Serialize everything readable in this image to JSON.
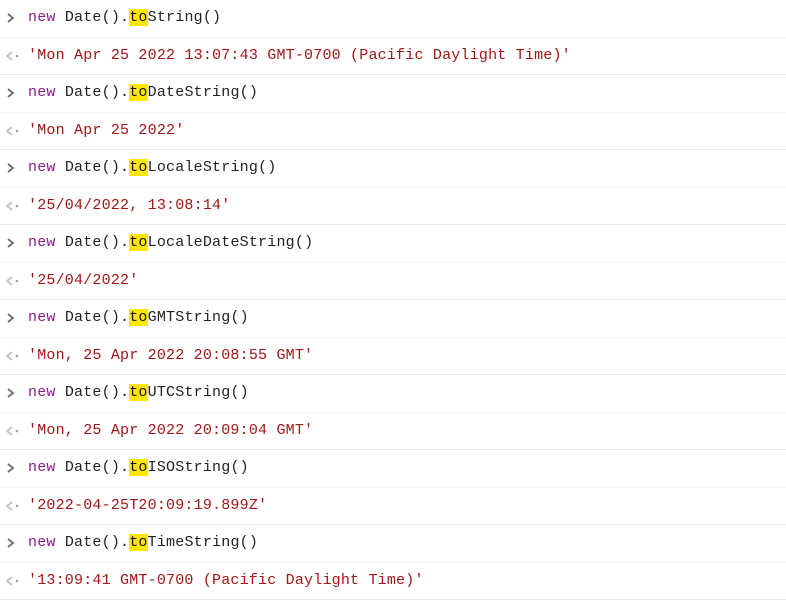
{
  "colors": {
    "keyword": "#8e1a8e",
    "string": "#a31515",
    "highlight_bg": "#ffe600",
    "input_chevron": "#6a6f77",
    "output_chevron": "#bfc3c8",
    "output_dot": "#9aa0a6",
    "border": "#e6e8ea"
  },
  "tokens": {
    "kw_new": "new",
    "sp": " ",
    "Date": "Date",
    "parens": "()",
    "dot": ".",
    "hl": "to"
  },
  "entries": [
    {
      "kind": "input",
      "method_rest": "String",
      "parens": "()"
    },
    {
      "kind": "output",
      "result": "'Mon Apr 25 2022 13:07:43 GMT-0700 (Pacific Daylight Time)'"
    },
    {
      "kind": "input",
      "method_rest": "DateString",
      "parens": "()"
    },
    {
      "kind": "output",
      "result": "'Mon Apr 25 2022'"
    },
    {
      "kind": "input",
      "method_rest": "LocaleString",
      "parens": "()"
    },
    {
      "kind": "output",
      "result": "'25/04/2022, 13:08:14'"
    },
    {
      "kind": "input",
      "method_rest": "LocaleDateString",
      "parens": "()"
    },
    {
      "kind": "output",
      "result": "'25/04/2022'"
    },
    {
      "kind": "input",
      "method_rest": "GMTString",
      "parens": "()"
    },
    {
      "kind": "output",
      "result": "'Mon, 25 Apr 2022 20:08:55 GMT'"
    },
    {
      "kind": "input",
      "method_rest": "UTCString",
      "parens": "()"
    },
    {
      "kind": "output",
      "result": "'Mon, 25 Apr 2022 20:09:04 GMT'"
    },
    {
      "kind": "input",
      "method_rest": "ISOString",
      "parens": "()"
    },
    {
      "kind": "output",
      "result": "'2022-04-25T20:09:19.899Z'"
    },
    {
      "kind": "input",
      "method_rest": "TimeString",
      "parens": "()"
    },
    {
      "kind": "output",
      "result": "'13:09:41 GMT-0700 (Pacific Daylight Time)'"
    }
  ]
}
